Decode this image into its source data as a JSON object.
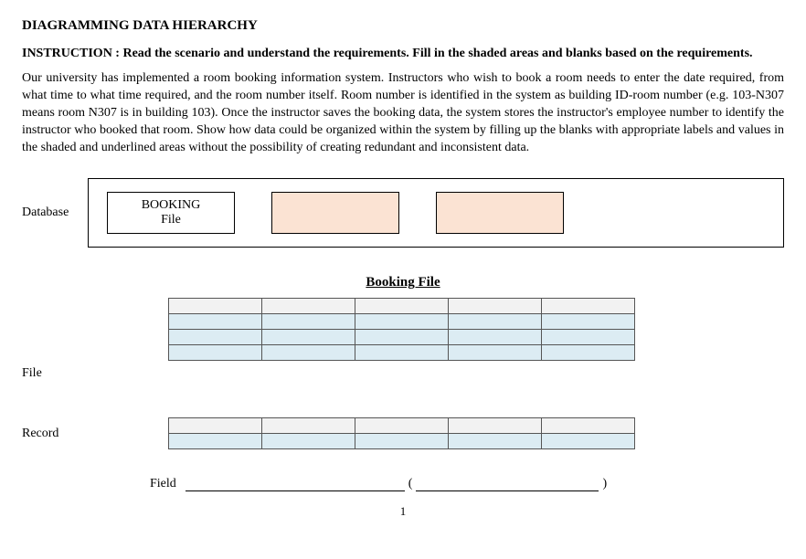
{
  "title": "DIAGRAMMING DATA HIERARCHY",
  "instruction": "INSTRUCTION : Read the scenario and understand the requirements. Fill in the shaded areas and blanks based on the requirements.",
  "scenario": "Our university has implemented a room booking information system. Instructors who wish to book a room needs to enter the date required, from what time to what time required, and the room number itself. Room number is identified in the system as building ID-room number (e.g. 103-N307 means room N307 is in building 103). Once the instructor saves the booking data, the system stores the instructor's employee number to identify the instructor who booked that room. Show how data could be organized within the system by filling up the blanks with appropriate labels and values in the shaded and underlined areas without the possibility of creating redundant and inconsistent data.",
  "labels": {
    "database": "Database",
    "file": "File",
    "record": "Record",
    "field": "Field"
  },
  "file_box": {
    "line1": "BOOKING",
    "line2": "File"
  },
  "booking_file_title": "Booking File",
  "page_number": "1"
}
